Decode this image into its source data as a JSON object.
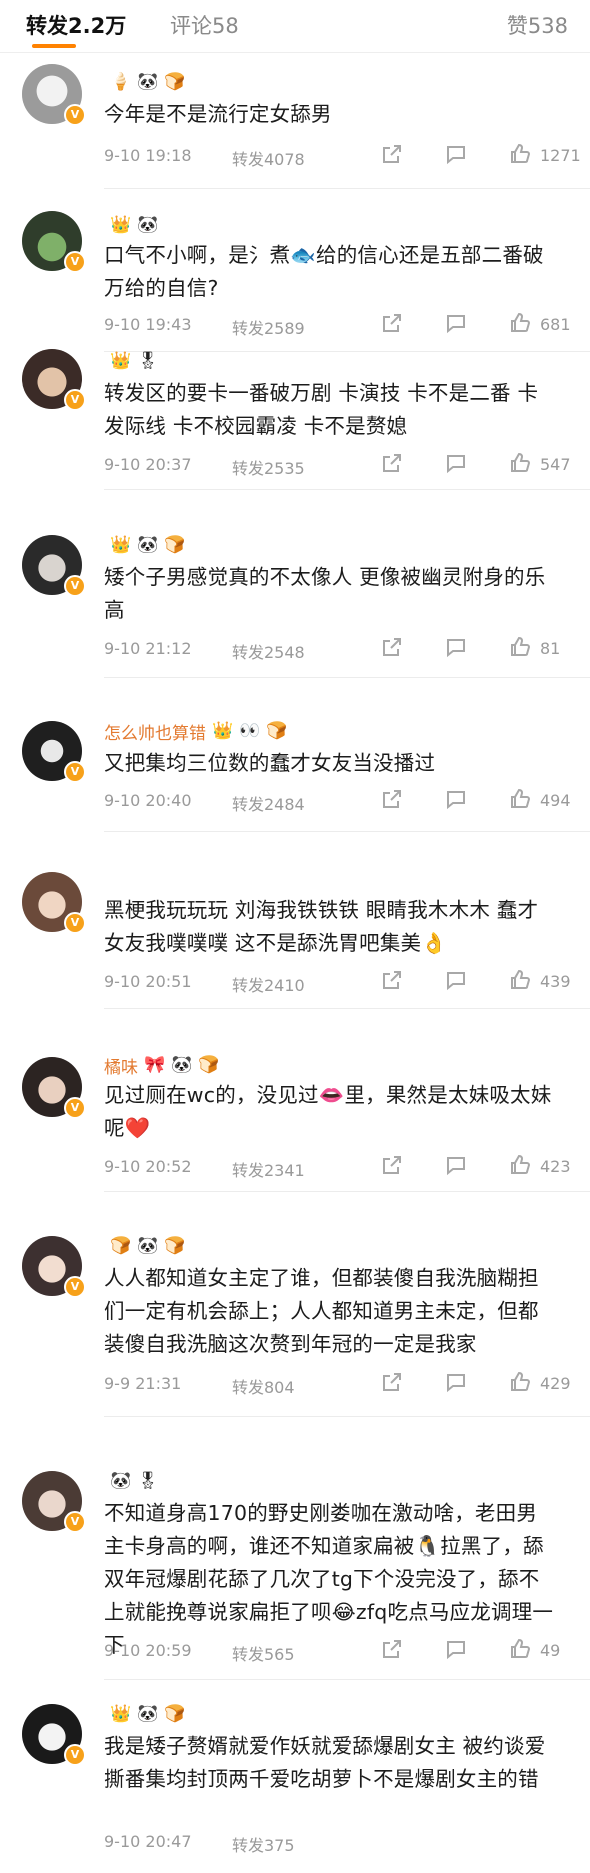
{
  "tabs": [
    {
      "label": "转发",
      "count": "2.2万"
    },
    {
      "label": "评论",
      "count": "58"
    },
    {
      "label": "赞",
      "count": "538"
    }
  ],
  "tab_labels": {
    "repost": "转发2.2万",
    "comment": "评论58",
    "like": "赞538"
  },
  "comments": [
    {
      "username": "",
      "badges": [
        "🍦",
        "🐼",
        "🍞"
      ],
      "text": "今年是不是流行定女舔男",
      "date": "9-10 19:18",
      "reposts": "转发4078",
      "likes": "1271"
    },
    {
      "username": "",
      "badges": [
        "👑",
        "🐼"
      ],
      "text": "口气不小啊，是氵煮🐟给的信心还是五部二番破万给的自信?",
      "date": "9-10 19:43",
      "reposts": "转发2589",
      "likes": "681"
    },
    {
      "username": "",
      "badges": [
        "👑",
        "🎖"
      ],
      "text": "转发区的要卡一番破万剧 卡演技 卡不是二番 卡发际线 卡不校园霸凌 卡不是赘媳",
      "date": "9-10 20:37",
      "reposts": "转发2535",
      "likes": "547"
    },
    {
      "username": "",
      "badges": [
        "👑",
        "🐼",
        "🍞"
      ],
      "text": "矮个子男感觉真的不太像人 更像被幽灵附身的乐高",
      "date": "9-10 21:12",
      "reposts": "转发2548",
      "likes": "81"
    },
    {
      "username": "怎么帅也算错",
      "badges": [
        "👑",
        "👀",
        "🍞"
      ],
      "text": "又把集均三位数的蠢才女友当没播过",
      "date": "9-10 20:40",
      "reposts": "转发2484",
      "likes": "494"
    },
    {
      "username": "",
      "badges": [],
      "text": "黑梗我玩玩玩 刘海我铁铁铁 眼睛我木木木 蠢才女友我噗噗噗 这不是舔洗胃吧集美👌",
      "date": "9-10 20:51",
      "reposts": "转发2410",
      "likes": "439"
    },
    {
      "username": "橘味",
      "badges": [
        "🎀",
        "🐼",
        "🍞"
      ],
      "text": "见过厕在wc的，没见过👄里，果然是太妹吸太妹呢❤️",
      "date": "9-10 20:52",
      "reposts": "转发2341",
      "likes": "423"
    },
    {
      "username": "",
      "badges": [
        "🍞",
        "🐼",
        "🍞"
      ],
      "text": "人人都知道女主定了谁，但都装傻自我洗脑糊担们一定有机会舔上；人人都知道男主未定，但都装傻自我洗脑这次赘到年冠的一定是我家",
      "date": "9-9 21:31",
      "reposts": "转发804",
      "likes": "429"
    },
    {
      "username": "",
      "badges": [
        "🐼",
        "🎖"
      ],
      "text": "不知道身高170的野史刚娄咖在激动啥，老田男主卡身高的啊，谁还不知道家扁被🐧拉黑了，舔双年冠爆剧花舔了几次了tg下个没完没了，舔不上就能挽尊说家扁拒了呗😂zfq吃点马应龙调理一下",
      "date": "9-10 20:59",
      "reposts": "转发565",
      "likes": "49"
    },
    {
      "username": "",
      "badges": [
        "👑",
        "🐼",
        "🍞"
      ],
      "text": "我是矮子赘婿就爱作妖就爱舔爆剧女主 被约谈爱撕番集均封顶两千爱吃胡萝卜不是爆剧女主的错",
      "date": "9-10 20:47",
      "reposts": "转发375",
      "likes": ""
    }
  ],
  "colors": {
    "accent": "#ff8200",
    "username": "#e37a30",
    "meta": "#9a9a9a"
  }
}
